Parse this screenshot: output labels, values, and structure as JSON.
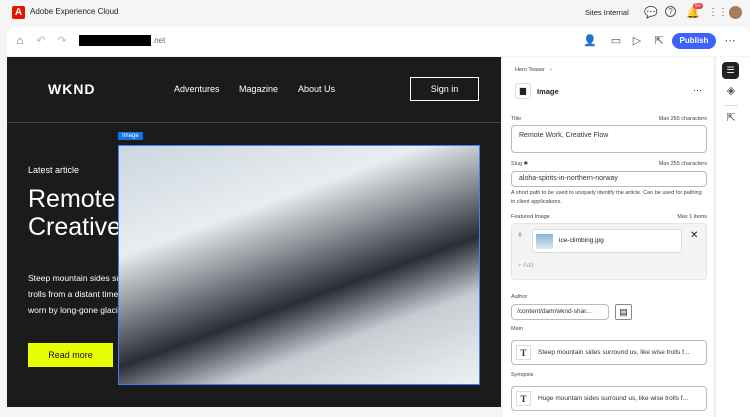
{
  "app": {
    "name": "Adobe Experience Cloud",
    "logo": "A",
    "org": "Sites Internal",
    "notif_count": "9+"
  },
  "toolbar": {
    "url_suffix": ".net",
    "publish": "Publish"
  },
  "site": {
    "brand": "WKND",
    "nav": [
      "Adventures",
      "Magazine",
      "About Us"
    ],
    "signin": "Sign in",
    "hero": {
      "eyebrow": "Latest article",
      "title": "Remote Work, Creative Flow",
      "body": "Steep mountain sides surround us, like wise trolls from a distant timeline, weathered and worn by long-gone glaciers, green moss n...",
      "cta": "Read more",
      "image_badge": "Image"
    }
  },
  "panel": {
    "breadcrumb": "Hero Teaser",
    "component": "Image",
    "title_label": "Title",
    "title_hint": "Max 255 characters",
    "title_value": "Remote Work, Creative Flow",
    "slug_label": "Slug",
    "slug_req": "✱",
    "slug_hint": "Max 255 characters",
    "slug_value": "aloha-spirits-in-northern-norway",
    "slug_help": "A short path to be used to uniquely identify the article. Can be used for pathing in client applications.",
    "featured_label": "Featured Image",
    "featured_hint": "Max 1 items",
    "featured_file": "ice-climbing.jpg",
    "add": "+ Add",
    "author_label": "Author",
    "author_value": "/content/dam/wknd-shar...",
    "main_label": "Main",
    "main_value": "Steep mountain sides surround us, like wise trolls f...",
    "synopsis_label": "Synopsis",
    "synopsis_value": "Huge mountain sides surround us, like wise trolls f..."
  }
}
